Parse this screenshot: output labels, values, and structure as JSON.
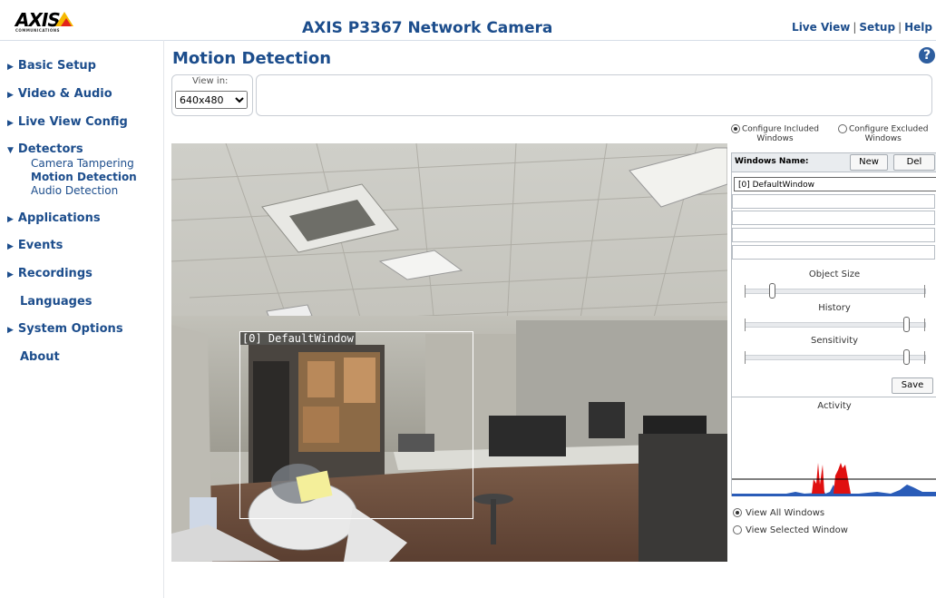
{
  "header": {
    "logo_text": "AXIS",
    "logo_sub": "COMMUNICATIONS",
    "title": "AXIS P3367 Network Camera",
    "links": [
      "Live View",
      "Setup",
      "Help"
    ]
  },
  "sidebar": {
    "items": [
      {
        "label": "Basic Setup"
      },
      {
        "label": "Video & Audio"
      },
      {
        "label": "Live View Config"
      },
      {
        "label": "Detectors"
      },
      {
        "label": "Applications"
      },
      {
        "label": "Events"
      },
      {
        "label": "Recordings"
      },
      {
        "label": "Languages"
      },
      {
        "label": "System Options"
      },
      {
        "label": "About"
      }
    ],
    "detectors_sub": [
      "Camera Tampering",
      "Motion Detection",
      "Audio Detection"
    ]
  },
  "main": {
    "title": "Motion Detection",
    "view_in_label": "View in:",
    "view_in_value": "640x480",
    "window_label": "[0] DefaultWindow"
  },
  "config": {
    "included_label": "Configure Included",
    "included_sub": "Windows",
    "excluded_label": "Configure Excluded",
    "excluded_sub": "Windows",
    "selected": "included"
  },
  "windows_panel": {
    "title": "Windows Name:",
    "new_label": "New",
    "del_label": "Del",
    "rows": [
      "[0] DefaultWindow",
      "",
      "",
      "",
      ""
    ]
  },
  "sliders": {
    "object_size_label": "Object Size",
    "object_size_value": 0.15,
    "history_label": "History",
    "history_value": 0.9,
    "sensitivity_label": "Sensitivity",
    "sensitivity_value": 0.9
  },
  "save_label": "Save",
  "activity_label": "Activity",
  "view_options": {
    "all_label": "View All Windows",
    "selected_label": "View Selected Window",
    "selected": "all"
  },
  "colors": {
    "brand_blue": "#1c4d8c",
    "activity_red": "#e01010",
    "activity_blue": "#2a5cb8"
  },
  "icons": [
    "help-icon",
    "axis-logo"
  ]
}
